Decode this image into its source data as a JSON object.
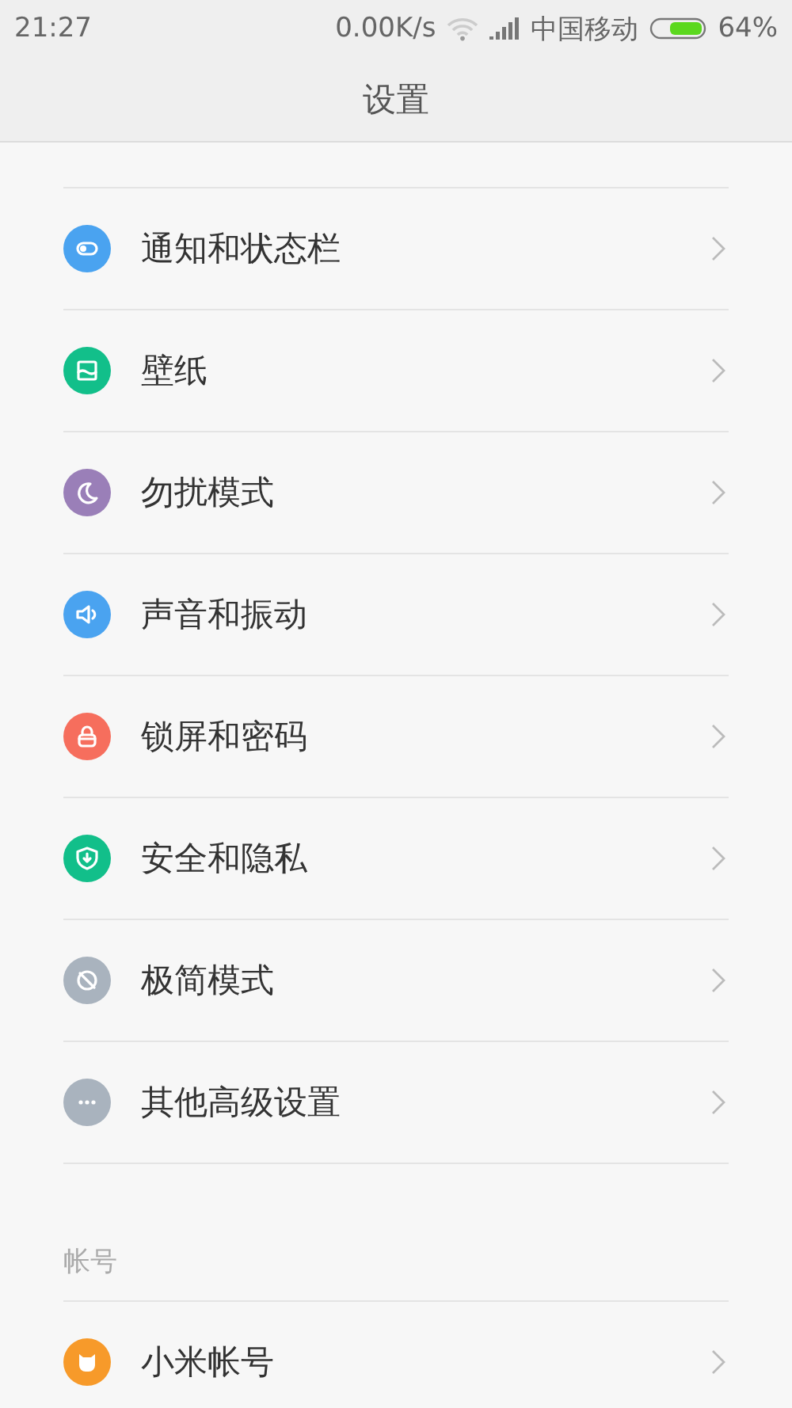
{
  "status_bar": {
    "time": "21:27",
    "speed": "0.00K/s",
    "carrier": "中国移动",
    "battery": "64%"
  },
  "title": "设置",
  "sections": [
    {
      "items": [
        {
          "label": "通知和状态栏",
          "kind": "toggle",
          "color": "#4aa3f0"
        },
        {
          "label": "壁纸",
          "kind": "wallpaper",
          "color": "#12bf8a"
        },
        {
          "label": "勿扰模式",
          "kind": "moon",
          "color": "#9a7fb8"
        },
        {
          "label": "声音和振动",
          "kind": "speaker",
          "color": "#4aa3f0"
        },
        {
          "label": "锁屏和密码",
          "kind": "lock",
          "color": "#f66e5d"
        },
        {
          "label": "安全和隐私",
          "kind": "shield",
          "color": "#12bf8a"
        },
        {
          "label": "极简模式",
          "kind": "slash",
          "color": "#a9b3be"
        },
        {
          "label": "其他高级设置",
          "kind": "more",
          "color": "#a9b3be"
        }
      ]
    },
    {
      "header": "帐号",
      "items": [
        {
          "label": "小米帐号",
          "kind": "mi",
          "color": "#f79a2a"
        }
      ]
    }
  ]
}
